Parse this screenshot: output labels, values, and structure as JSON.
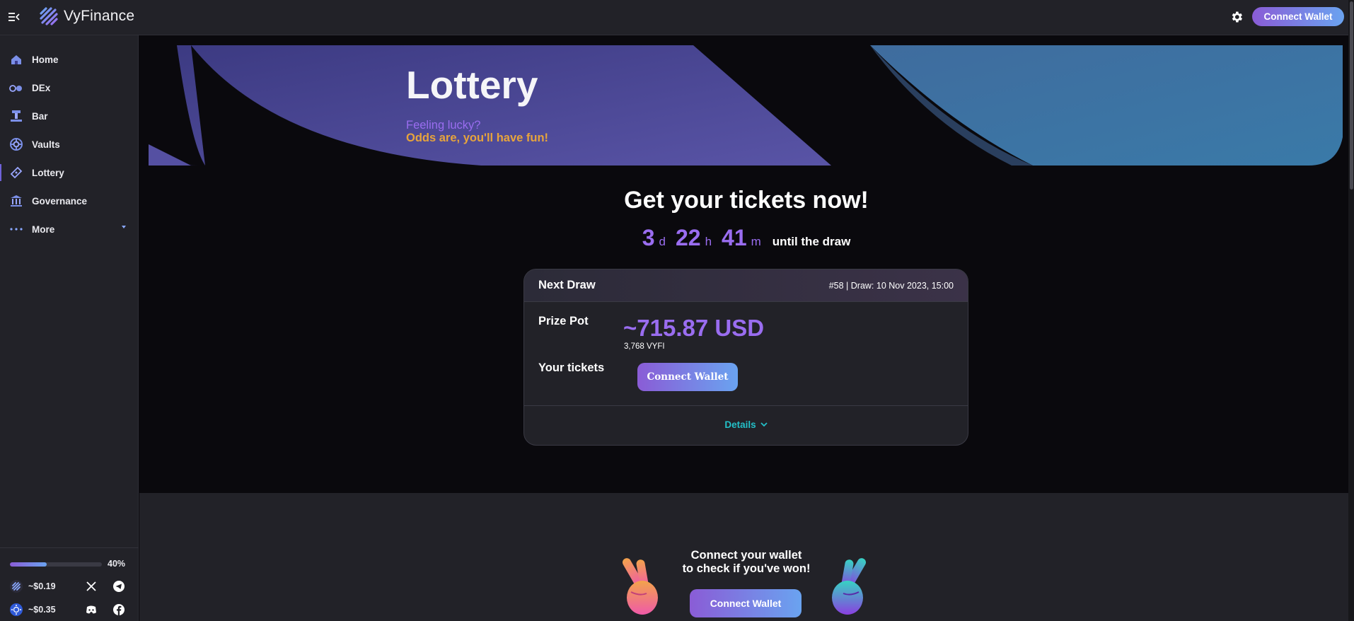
{
  "app": {
    "name": "VyFinance"
  },
  "header": {
    "connect_label": "Connect Wallet"
  },
  "sidebar": {
    "items": [
      {
        "label": "Home",
        "icon": "home-icon"
      },
      {
        "label": "DEx",
        "icon": "dex-icon"
      },
      {
        "label": "Bar",
        "icon": "bar-icon"
      },
      {
        "label": "Vaults",
        "icon": "vault-icon"
      },
      {
        "label": "Lottery",
        "icon": "ticket-icon"
      },
      {
        "label": "Governance",
        "icon": "governance-icon"
      },
      {
        "label": "More",
        "icon": "dots-icon"
      }
    ],
    "active": "Lottery",
    "progress": {
      "value": 40,
      "label": "40%"
    },
    "prices": [
      {
        "label": "~$0.19",
        "icon": "vyfi-token-icon"
      },
      {
        "label": "~$0.35",
        "icon": "ada-token-icon"
      }
    ],
    "socials": [
      "x-icon",
      "telegram-icon",
      "discord-icon",
      "facebook-icon"
    ]
  },
  "hero": {
    "title": "Lottery",
    "subtitle_line1": "Feeling lucky?",
    "subtitle_line2": "Odds are, you'll have fun!"
  },
  "countdown": {
    "heading": "Get your tickets now!",
    "days": "3",
    "days_unit": "d",
    "hours": "22",
    "hours_unit": "h",
    "minutes": "41",
    "minutes_unit": "m",
    "tail": "until the draw"
  },
  "draw_card": {
    "title": "Next Draw",
    "meta": "#58 | Draw: 10 Nov 2023, 15:00",
    "prize_label": "Prize Pot",
    "prize_value": "~715.87 USD",
    "prize_sub": "3,768 VYFI",
    "tickets_label": "Your tickets",
    "connect_label": "Connect Wallet",
    "details_label": "Details"
  },
  "check_win": {
    "line1": "Connect your wallet",
    "line2": "to check if you've won!",
    "connect_label": "Connect Wallet"
  },
  "colors": {
    "accent_purple": "#9a6df0",
    "accent_orange": "#e7a43c",
    "teal": "#23c0c8",
    "gradient_start": "#8a5cd6",
    "gradient_end": "#6aa3f0"
  }
}
